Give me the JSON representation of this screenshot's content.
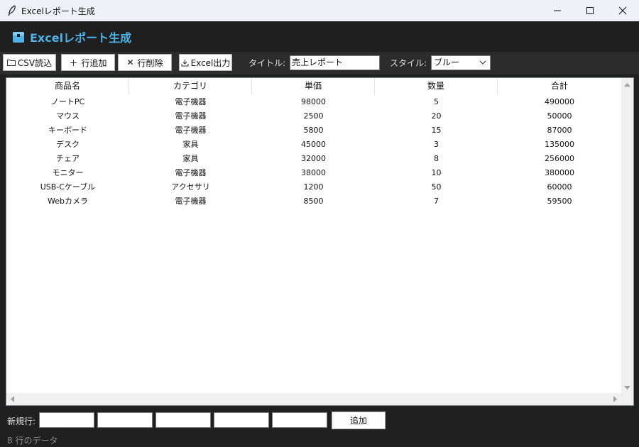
{
  "window": {
    "title": "Excelレポート生成"
  },
  "header": {
    "title": "Excelレポート生成",
    "icon": "package-icon",
    "accent": "#4fb3e8"
  },
  "toolbar": {
    "csv_label": "CSV読込",
    "add_row_label": "行追加",
    "delete_row_label": "行削除",
    "export_label": "Excel出力",
    "title_label": "タイトル:",
    "title_value": "売上レポート",
    "style_label": "スタイル:",
    "style_value": "ブルー"
  },
  "table": {
    "columns": [
      "商品名",
      "カテゴリ",
      "単価",
      "数量",
      "合計"
    ],
    "rows": [
      [
        "ノートPC",
        "電子機器",
        "98000",
        "5",
        "490000"
      ],
      [
        "マウス",
        "電子機器",
        "2500",
        "20",
        "50000"
      ],
      [
        "キーボード",
        "電子機器",
        "5800",
        "15",
        "87000"
      ],
      [
        "デスク",
        "家具",
        "45000",
        "3",
        "135000"
      ],
      [
        "チェア",
        "家具",
        "32000",
        "8",
        "256000"
      ],
      [
        "モニター",
        "電子機器",
        "38000",
        "10",
        "380000"
      ],
      [
        "USB-Cケーブル",
        "アクセサリ",
        "1200",
        "50",
        "60000"
      ],
      [
        "Webカメラ",
        "電子機器",
        "8500",
        "7",
        "59500"
      ]
    ]
  },
  "new_row": {
    "label": "新規行:",
    "add_label": "追加"
  },
  "status": {
    "text": "8 行のデータ"
  }
}
